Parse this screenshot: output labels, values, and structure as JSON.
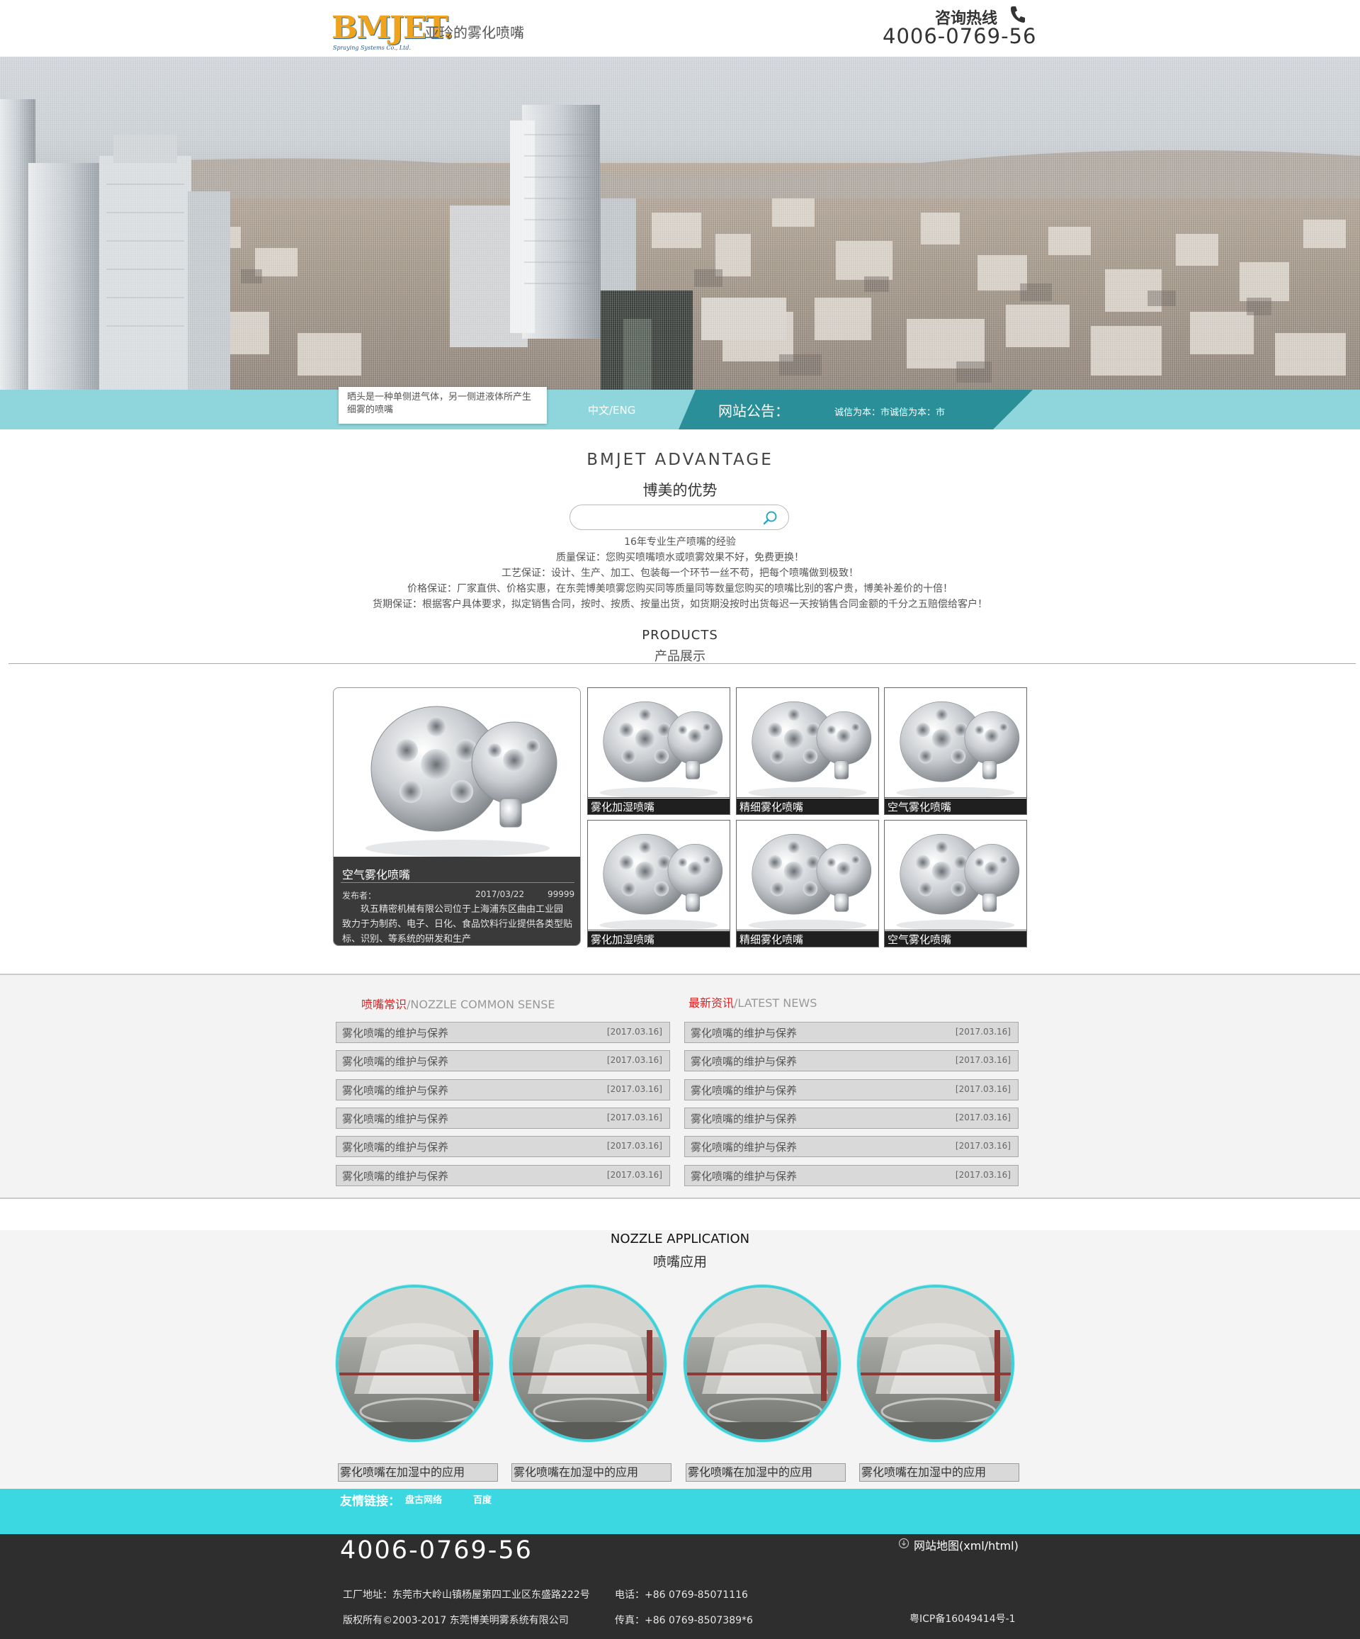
{
  "header": {
    "logo_text": "BMJET.",
    "logo_sub": "Spraying Systems Co., Ltd.",
    "slogan": "亚玲的雾化喷嘴",
    "hotline_label": "咨询热线",
    "hotline_number": "4006-0769-56"
  },
  "notice": {
    "intro": "晒头是一种单侧进气体，另一侧进液体所产生细雾的喷嘴",
    "lang": "中文/ENG",
    "label": "网站公告：",
    "text": "诚信为本：市诚信为本：市"
  },
  "advantage": {
    "title_en": "BMJET ADVANTAGE",
    "title_cn": "博美的优势",
    "search_placeholder": "",
    "lines": [
      "16年专业生产喷嘴的经验",
      "质量保证：您购买喷嘴喷水或喷雾效果不好，免费更换！",
      "工艺保证：设计、生产、加工、包装每一个环节一丝不苟，把每个喷嘴做到极致！",
      "价格保证：厂家直供、价格实惠，在东莞博美喷雾您购买同等质量同等数量您购买的喷嘴比别的客户贵，博美补差价的十倍！",
      "货期保证：根据客户具体要求，拟定销售合同，按时、按质、按量出货，如货期没按时出货每迟一天按销售合同金额的千分之五赔偿给客户！"
    ]
  },
  "products": {
    "title_en": "PRODUCTS",
    "title_cn": "产品展示",
    "featured": {
      "title": "空气雾化喷嘴",
      "publisher_label": "发布者：",
      "date": "2017/03/22",
      "views": "99999",
      "desc": "玖五精密机械有限公司位于上海浦东区曲由工业园 致力于为制药、电子、日化、食品饮料行业提供各类型贴标、识别、等系统的研发和生产"
    },
    "items": [
      {
        "caption": "雾化加湿喷嘴"
      },
      {
        "caption": "精细雾化喷嘴"
      },
      {
        "caption": "空气雾化喷嘴"
      },
      {
        "caption": "雾化加湿喷嘴"
      },
      {
        "caption": "精细雾化喷嘴"
      },
      {
        "caption": "空气雾化喷嘴"
      }
    ]
  },
  "news": {
    "left_head_cn": "喷嘴常识",
    "left_head_en": "/NOZZLE COMMON SENSE",
    "right_head_cn": "最新资讯",
    "right_head_en": "/LATEST NEWS",
    "left": [
      {
        "title": "雾化喷嘴的维护与保养",
        "date": "[2017.03.16]"
      },
      {
        "title": "雾化喷嘴的维护与保养",
        "date": "[2017.03.16]"
      },
      {
        "title": "雾化喷嘴的维护与保养",
        "date": "[2017.03.16]"
      },
      {
        "title": "雾化喷嘴的维护与保养",
        "date": "[2017.03.16]"
      },
      {
        "title": "雾化喷嘴的维护与保养",
        "date": "[2017.03.16]"
      },
      {
        "title": "雾化喷嘴的维护与保养",
        "date": "[2017.03.16]"
      }
    ],
    "right": [
      {
        "title": "雾化喷嘴的维护与保养",
        "date": "[2017.03.16]"
      },
      {
        "title": "雾化喷嘴的维护与保养",
        "date": "[2017.03.16]"
      },
      {
        "title": "雾化喷嘴的维护与保养",
        "date": "[2017.03.16]"
      },
      {
        "title": "雾化喷嘴的维护与保养",
        "date": "[2017.03.16]"
      },
      {
        "title": "雾化喷嘴的维护与保养",
        "date": "[2017.03.16]"
      },
      {
        "title": "雾化喷嘴的维护与保养",
        "date": "[2017.03.16]"
      }
    ]
  },
  "application": {
    "title_en": "NOZZLE APPLICATION",
    "title_cn": "喷嘴应用",
    "items": [
      {
        "caption": "雾化喷嘴在加湿中的应用"
      },
      {
        "caption": "雾化喷嘴在加湿中的应用"
      },
      {
        "caption": "雾化喷嘴在加湿中的应用"
      },
      {
        "caption": "雾化喷嘴在加湿中的应用"
      }
    ]
  },
  "links": {
    "label": "友情链接：",
    "items": [
      "盘古网络",
      "百度"
    ]
  },
  "footer": {
    "phone": "4006-0769-56",
    "sitemap": "网站地图(xml/html)",
    "address": "工厂地址：东莞市大岭山镇杨屋第四工业区东盛路222号",
    "tel": "电话：+86 0769-85071116",
    "copyright": "版权所有©2003-2017 东莞博美明雾系统有限公司",
    "fax": "传真：+86 0769-8507389*6",
    "icp": "粤ICP备16049414号-1"
  },
  "colors": {
    "accent": "#3cd8e1",
    "notice_bar": "#8fd6dc",
    "notice_dark": "#2a8f98",
    "news_red": "#e02020",
    "footer_bg": "#2e2e2e"
  }
}
